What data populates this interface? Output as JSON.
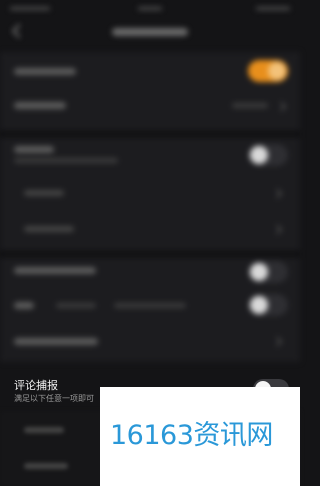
{
  "comment_capture": {
    "title": "评论捕报",
    "description": "满足以下任意一项即可"
  },
  "watermark": {
    "text": "16163资讯网"
  },
  "colors": {
    "accent_toggle_on": "#e88f1c",
    "watermark_text": "#2a98d8",
    "background": "#141416"
  },
  "icons": [
    "back-icon",
    "chevron-right-icon"
  ]
}
